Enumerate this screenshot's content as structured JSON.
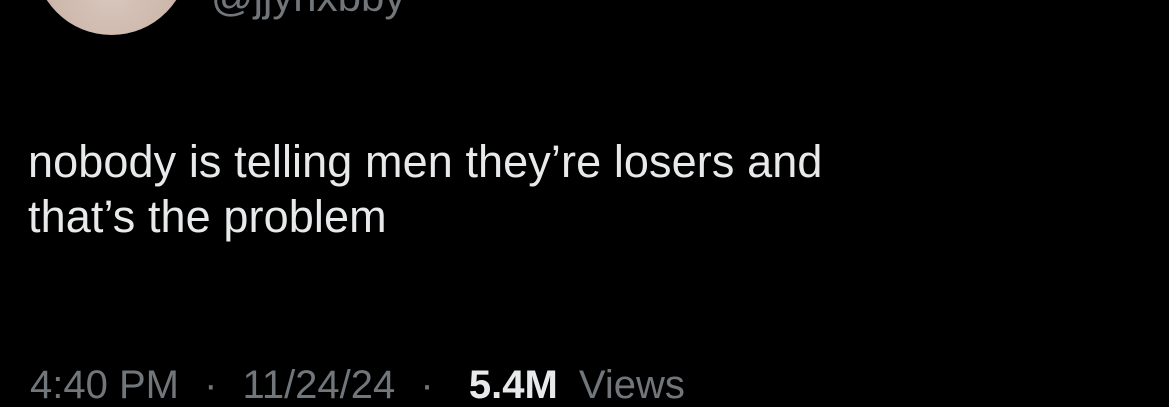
{
  "tweet": {
    "handle": "@jjyrixbby",
    "text_lines": [
      "nobody is telling men they’re losers and",
      "that’s the problem"
    ],
    "time": "4:40 PM",
    "date": "11/24/24",
    "views_count": "5.4M",
    "views_label": "Views"
  },
  "colors": {
    "background": "#000000",
    "primary_text": "#e7e9ea",
    "secondary_text": "#71767b"
  }
}
